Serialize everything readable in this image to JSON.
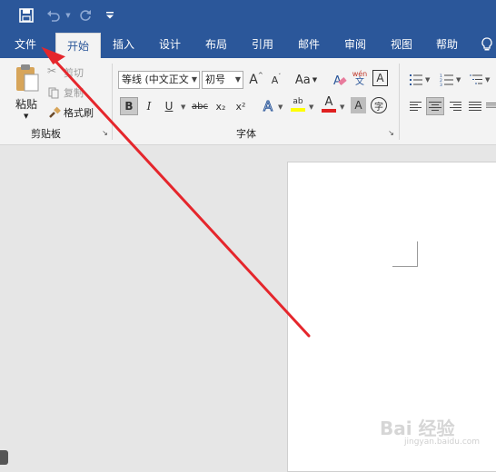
{
  "tabs": [
    {
      "label": "文件"
    },
    {
      "label": "开始"
    },
    {
      "label": "插入"
    },
    {
      "label": "设计"
    },
    {
      "label": "布局"
    },
    {
      "label": "引用"
    },
    {
      "label": "邮件"
    },
    {
      "label": "审阅"
    },
    {
      "label": "视图"
    },
    {
      "label": "帮助"
    }
  ],
  "clipboard": {
    "paste_label": "粘贴",
    "cut_label": "剪切",
    "copy_label": "复制",
    "format_painter_label": "格式刷",
    "group_label": "剪贴板"
  },
  "font": {
    "font_name": "等线 (中文正文",
    "font_size": "初号",
    "grow_label": "A",
    "shrink_label": "A",
    "case_label": "Aa",
    "phonetic_top": "wén",
    "phonetic_bottom": "文",
    "border_char_label": "A",
    "bold_label": "B",
    "italic_label": "I",
    "underline_label": "U",
    "strike_label": "abc",
    "sub_label": "x₂",
    "sup_label": "x²",
    "effects_label": "A",
    "highlight_label": "ab",
    "color_label": "A",
    "shade_label": "A",
    "enclose_label": "字",
    "group_label": "字体"
  },
  "watermark": {
    "main": "Bai 经验",
    "sub": "jingyan.baidu.com"
  },
  "colors": {
    "accent": "#2b579a",
    "arrow": "#e5262c",
    "highlight": "#ffff00",
    "font_color": "#e02020"
  }
}
